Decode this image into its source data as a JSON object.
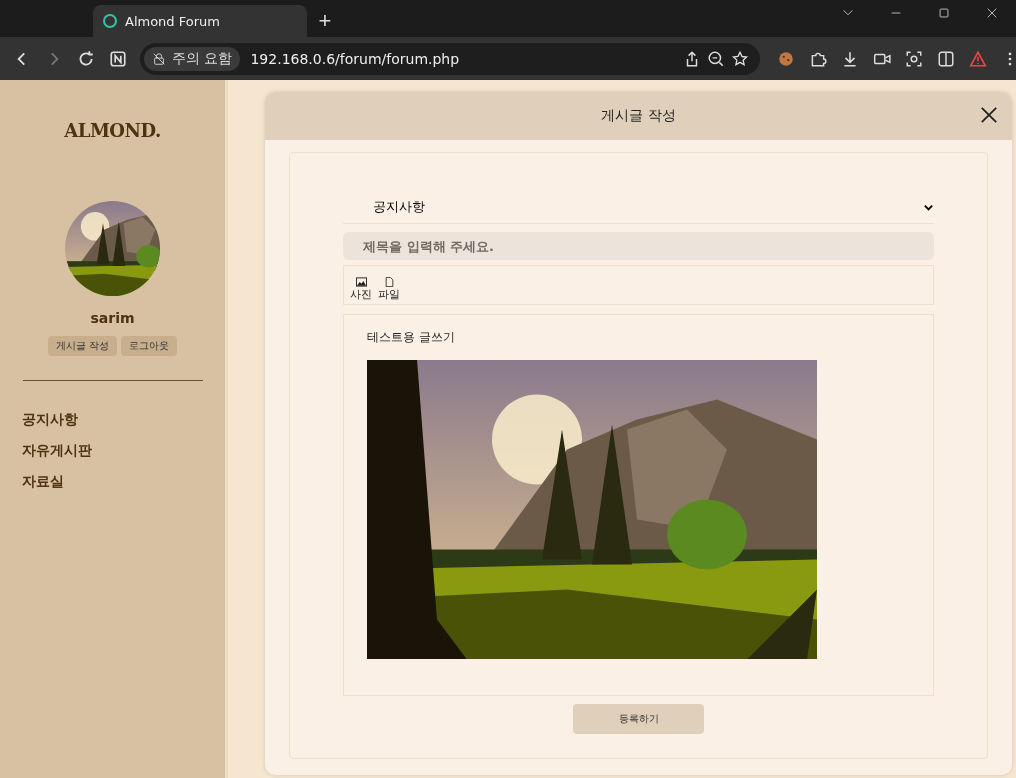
{
  "browser": {
    "tab_title": "Almond Forum",
    "new_tab": "+",
    "security_chip": "주의 요함",
    "url": "192.168.0.6/forum/forum.php"
  },
  "sidebar": {
    "logo": "ALMOND.",
    "username": "sarim",
    "buttons": [
      "게시글 작성",
      "로그아웃"
    ],
    "nav": [
      {
        "label": "공지사항"
      },
      {
        "label": "자유게시판"
      },
      {
        "label": "자료실"
      }
    ]
  },
  "modal": {
    "title": "게시글 작성",
    "category": "공지사항",
    "title_placeholder": "제목을 입력해 주세요.",
    "attach": [
      {
        "label": "사진"
      },
      {
        "kind": "file",
        "label": "파일"
      }
    ],
    "body_text": "테스트용 글쓰기",
    "submit": "등록하기"
  }
}
